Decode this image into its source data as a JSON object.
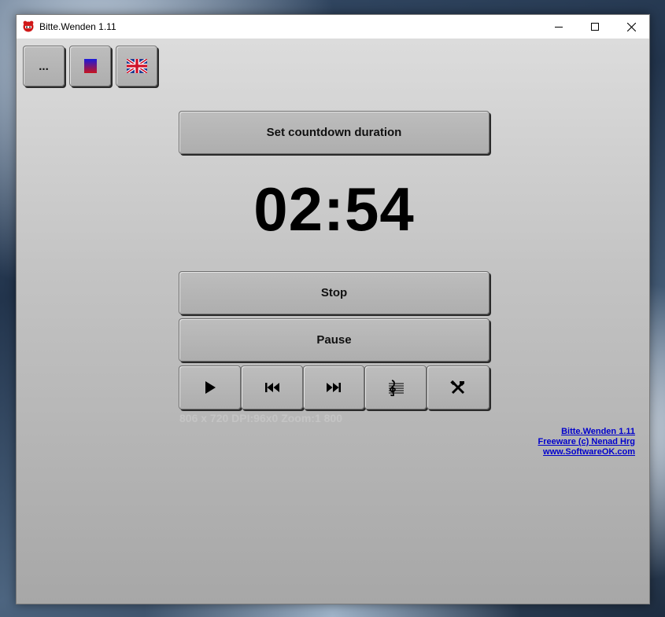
{
  "window": {
    "title": "Bitte.Wenden 1.11",
    "controls": {
      "minimize_icon": "minimize-icon",
      "maximize_icon": "maximize-icon",
      "close_icon": "close-icon"
    }
  },
  "toolbar": {
    "menu_label": "...",
    "color_icon": "color-swatch-icon",
    "language_icon": "uk-flag-icon"
  },
  "timer": {
    "set_duration_label": "Set countdown duration",
    "display": "02:54",
    "stop_label": "Stop",
    "pause_label": "Pause"
  },
  "media_controls": [
    {
      "icon": "play-icon",
      "glyph": "▶"
    },
    {
      "icon": "previous-track-icon",
      "glyph": "⏮"
    },
    {
      "icon": "next-track-icon",
      "glyph": "⏭"
    },
    {
      "icon": "music-sheet-icon",
      "glyph": "𝄞"
    },
    {
      "icon": "tools-icon",
      "glyph": "🛠"
    }
  ],
  "info": {
    "dpi_text": "806 x 720 DPI:96x0 Zoom:1 800"
  },
  "credits": {
    "app_link": "Bitte.Wenden 1.11",
    "freeware_link": "Freeware (c) Nenad Hrg",
    "site_link": "www.SoftwareOK.com"
  },
  "colors": {
    "link": "#0000cc",
    "button_face": "#b3b3b3"
  }
}
